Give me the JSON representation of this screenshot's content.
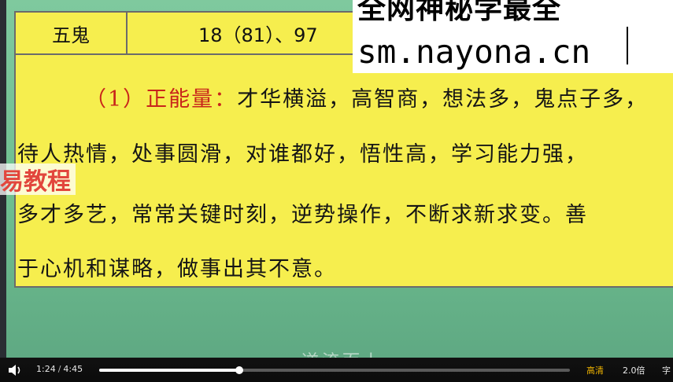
{
  "slide": {
    "table_label": "五鬼",
    "table_numbers": "18（81）、97",
    "lines": [
      {
        "prefix": "（1）正能量：",
        "text": "才华横溢，高智商，想法多，鬼点子多，"
      },
      {
        "prefix": "",
        "text": "待人热情，处事圆滑，对谁都好，悟性高，学习能力强，"
      },
      {
        "prefix": "",
        "text": "多才多艺，常常关键时刻，逆势操作，不断求新求变。善"
      },
      {
        "prefix": "",
        "text": "于心机和谋略，做事出其不意。"
      }
    ]
  },
  "watermark": {
    "top_text": "全网神秘学最全",
    "url_text": "sm.nayona.cn"
  },
  "logo_text": "易教程",
  "subtitle": "逆流而上",
  "player": {
    "current_time": "1:24",
    "separator": "/",
    "duration": "4:45",
    "progress": 0.297,
    "quality_label": "高清",
    "speed_label": "2.0倍",
    "caption_label": "字"
  },
  "colors": {
    "slide_bg": "#f6ee4e",
    "highlight_red": "#c8241b",
    "background_green": "#7fc99e",
    "quality_color": "#f0b400"
  }
}
